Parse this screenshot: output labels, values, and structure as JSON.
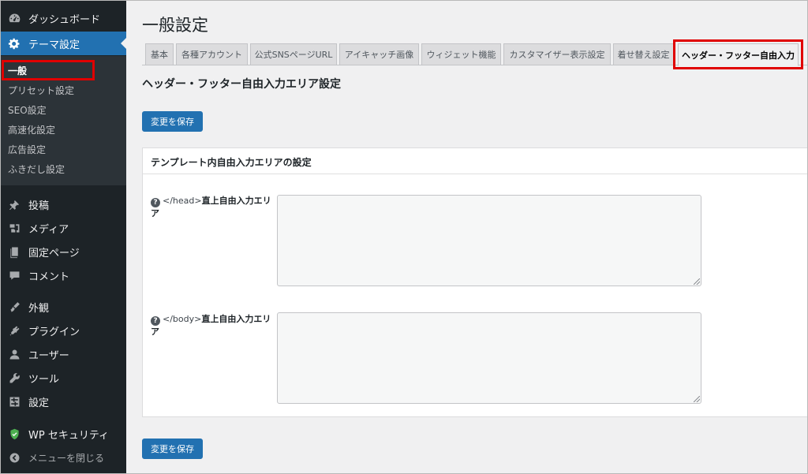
{
  "sidebar": {
    "items": [
      {
        "label": "ダッシュボード",
        "icon": "dashboard-icon"
      },
      {
        "label": "テーマ設定",
        "icon": "gear-icon"
      },
      {
        "label": "投稿",
        "icon": "pin-icon"
      },
      {
        "label": "メディア",
        "icon": "media-icon"
      },
      {
        "label": "固定ページ",
        "icon": "page-icon"
      },
      {
        "label": "コメント",
        "icon": "comment-icon"
      },
      {
        "label": "外観",
        "icon": "brush-icon"
      },
      {
        "label": "プラグイン",
        "icon": "plugin-icon"
      },
      {
        "label": "ユーザー",
        "icon": "user-icon"
      },
      {
        "label": "ツール",
        "icon": "wrench-icon"
      },
      {
        "label": "設定",
        "icon": "settings-icon"
      },
      {
        "label": "WP セキュリティ",
        "icon": "shield-icon"
      },
      {
        "label": "メニューを閉じる",
        "icon": "collapse-icon"
      }
    ],
    "submenu": [
      "一般",
      "プリセット設定",
      "SEO設定",
      "高速化設定",
      "広告設定",
      "ふきだし設定"
    ]
  },
  "page": {
    "title": "一般設定"
  },
  "tabs": [
    "基本",
    "各種アカウント",
    "公式SNSページURL",
    "アイキャッチ画像",
    "ウィジェット機能",
    "カスタマイザー表示設定",
    "着せ替え設定",
    "ヘッダー・フッター自由入力"
  ],
  "section": {
    "heading": "ヘッダー・フッター自由入力エリア設定"
  },
  "save_button": "変更を保存",
  "panel": {
    "title": "テンプレート内自由入力エリアの設定",
    "fields": [
      {
        "code": "</head>",
        "label": "直上自由入力エリア",
        "value": ""
      },
      {
        "code": "</body>",
        "label": "直上自由入力エリア",
        "value": ""
      }
    ]
  },
  "colors": {
    "accent": "#2271b1",
    "sidebar": "#1d2327",
    "highlight": "#e00000"
  }
}
